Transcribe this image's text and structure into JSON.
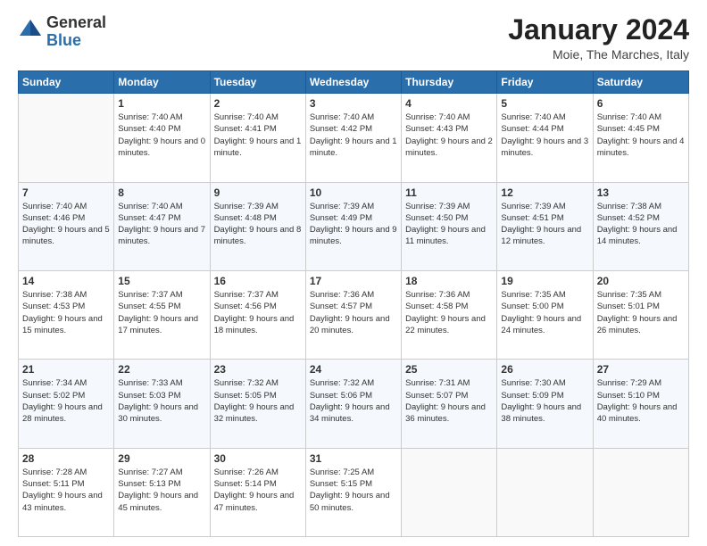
{
  "logo": {
    "general": "General",
    "blue": "Blue"
  },
  "header": {
    "month": "January 2024",
    "location": "Moie, The Marches, Italy"
  },
  "weekdays": [
    "Sunday",
    "Monday",
    "Tuesday",
    "Wednesday",
    "Thursday",
    "Friday",
    "Saturday"
  ],
  "weeks": [
    [
      {
        "day": "",
        "sunrise": "",
        "sunset": "",
        "daylight": ""
      },
      {
        "day": "1",
        "sunrise": "Sunrise: 7:40 AM",
        "sunset": "Sunset: 4:40 PM",
        "daylight": "Daylight: 9 hours and 0 minutes."
      },
      {
        "day": "2",
        "sunrise": "Sunrise: 7:40 AM",
        "sunset": "Sunset: 4:41 PM",
        "daylight": "Daylight: 9 hours and 1 minute."
      },
      {
        "day": "3",
        "sunrise": "Sunrise: 7:40 AM",
        "sunset": "Sunset: 4:42 PM",
        "daylight": "Daylight: 9 hours and 1 minute."
      },
      {
        "day": "4",
        "sunrise": "Sunrise: 7:40 AM",
        "sunset": "Sunset: 4:43 PM",
        "daylight": "Daylight: 9 hours and 2 minutes."
      },
      {
        "day": "5",
        "sunrise": "Sunrise: 7:40 AM",
        "sunset": "Sunset: 4:44 PM",
        "daylight": "Daylight: 9 hours and 3 minutes."
      },
      {
        "day": "6",
        "sunrise": "Sunrise: 7:40 AM",
        "sunset": "Sunset: 4:45 PM",
        "daylight": "Daylight: 9 hours and 4 minutes."
      }
    ],
    [
      {
        "day": "7",
        "sunrise": "Sunrise: 7:40 AM",
        "sunset": "Sunset: 4:46 PM",
        "daylight": "Daylight: 9 hours and 5 minutes."
      },
      {
        "day": "8",
        "sunrise": "Sunrise: 7:40 AM",
        "sunset": "Sunset: 4:47 PM",
        "daylight": "Daylight: 9 hours and 7 minutes."
      },
      {
        "day": "9",
        "sunrise": "Sunrise: 7:39 AM",
        "sunset": "Sunset: 4:48 PM",
        "daylight": "Daylight: 9 hours and 8 minutes."
      },
      {
        "day": "10",
        "sunrise": "Sunrise: 7:39 AM",
        "sunset": "Sunset: 4:49 PM",
        "daylight": "Daylight: 9 hours and 9 minutes."
      },
      {
        "day": "11",
        "sunrise": "Sunrise: 7:39 AM",
        "sunset": "Sunset: 4:50 PM",
        "daylight": "Daylight: 9 hours and 11 minutes."
      },
      {
        "day": "12",
        "sunrise": "Sunrise: 7:39 AM",
        "sunset": "Sunset: 4:51 PM",
        "daylight": "Daylight: 9 hours and 12 minutes."
      },
      {
        "day": "13",
        "sunrise": "Sunrise: 7:38 AM",
        "sunset": "Sunset: 4:52 PM",
        "daylight": "Daylight: 9 hours and 14 minutes."
      }
    ],
    [
      {
        "day": "14",
        "sunrise": "Sunrise: 7:38 AM",
        "sunset": "Sunset: 4:53 PM",
        "daylight": "Daylight: 9 hours and 15 minutes."
      },
      {
        "day": "15",
        "sunrise": "Sunrise: 7:37 AM",
        "sunset": "Sunset: 4:55 PM",
        "daylight": "Daylight: 9 hours and 17 minutes."
      },
      {
        "day": "16",
        "sunrise": "Sunrise: 7:37 AM",
        "sunset": "Sunset: 4:56 PM",
        "daylight": "Daylight: 9 hours and 18 minutes."
      },
      {
        "day": "17",
        "sunrise": "Sunrise: 7:36 AM",
        "sunset": "Sunset: 4:57 PM",
        "daylight": "Daylight: 9 hours and 20 minutes."
      },
      {
        "day": "18",
        "sunrise": "Sunrise: 7:36 AM",
        "sunset": "Sunset: 4:58 PM",
        "daylight": "Daylight: 9 hours and 22 minutes."
      },
      {
        "day": "19",
        "sunrise": "Sunrise: 7:35 AM",
        "sunset": "Sunset: 5:00 PM",
        "daylight": "Daylight: 9 hours and 24 minutes."
      },
      {
        "day": "20",
        "sunrise": "Sunrise: 7:35 AM",
        "sunset": "Sunset: 5:01 PM",
        "daylight": "Daylight: 9 hours and 26 minutes."
      }
    ],
    [
      {
        "day": "21",
        "sunrise": "Sunrise: 7:34 AM",
        "sunset": "Sunset: 5:02 PM",
        "daylight": "Daylight: 9 hours and 28 minutes."
      },
      {
        "day": "22",
        "sunrise": "Sunrise: 7:33 AM",
        "sunset": "Sunset: 5:03 PM",
        "daylight": "Daylight: 9 hours and 30 minutes."
      },
      {
        "day": "23",
        "sunrise": "Sunrise: 7:32 AM",
        "sunset": "Sunset: 5:05 PM",
        "daylight": "Daylight: 9 hours and 32 minutes."
      },
      {
        "day": "24",
        "sunrise": "Sunrise: 7:32 AM",
        "sunset": "Sunset: 5:06 PM",
        "daylight": "Daylight: 9 hours and 34 minutes."
      },
      {
        "day": "25",
        "sunrise": "Sunrise: 7:31 AM",
        "sunset": "Sunset: 5:07 PM",
        "daylight": "Daylight: 9 hours and 36 minutes."
      },
      {
        "day": "26",
        "sunrise": "Sunrise: 7:30 AM",
        "sunset": "Sunset: 5:09 PM",
        "daylight": "Daylight: 9 hours and 38 minutes."
      },
      {
        "day": "27",
        "sunrise": "Sunrise: 7:29 AM",
        "sunset": "Sunset: 5:10 PM",
        "daylight": "Daylight: 9 hours and 40 minutes."
      }
    ],
    [
      {
        "day": "28",
        "sunrise": "Sunrise: 7:28 AM",
        "sunset": "Sunset: 5:11 PM",
        "daylight": "Daylight: 9 hours and 43 minutes."
      },
      {
        "day": "29",
        "sunrise": "Sunrise: 7:27 AM",
        "sunset": "Sunset: 5:13 PM",
        "daylight": "Daylight: 9 hours and 45 minutes."
      },
      {
        "day": "30",
        "sunrise": "Sunrise: 7:26 AM",
        "sunset": "Sunset: 5:14 PM",
        "daylight": "Daylight: 9 hours and 47 minutes."
      },
      {
        "day": "31",
        "sunrise": "Sunrise: 7:25 AM",
        "sunset": "Sunset: 5:15 PM",
        "daylight": "Daylight: 9 hours and 50 minutes."
      },
      {
        "day": "",
        "sunrise": "",
        "sunset": "",
        "daylight": ""
      },
      {
        "day": "",
        "sunrise": "",
        "sunset": "",
        "daylight": ""
      },
      {
        "day": "",
        "sunrise": "",
        "sunset": "",
        "daylight": ""
      }
    ]
  ]
}
